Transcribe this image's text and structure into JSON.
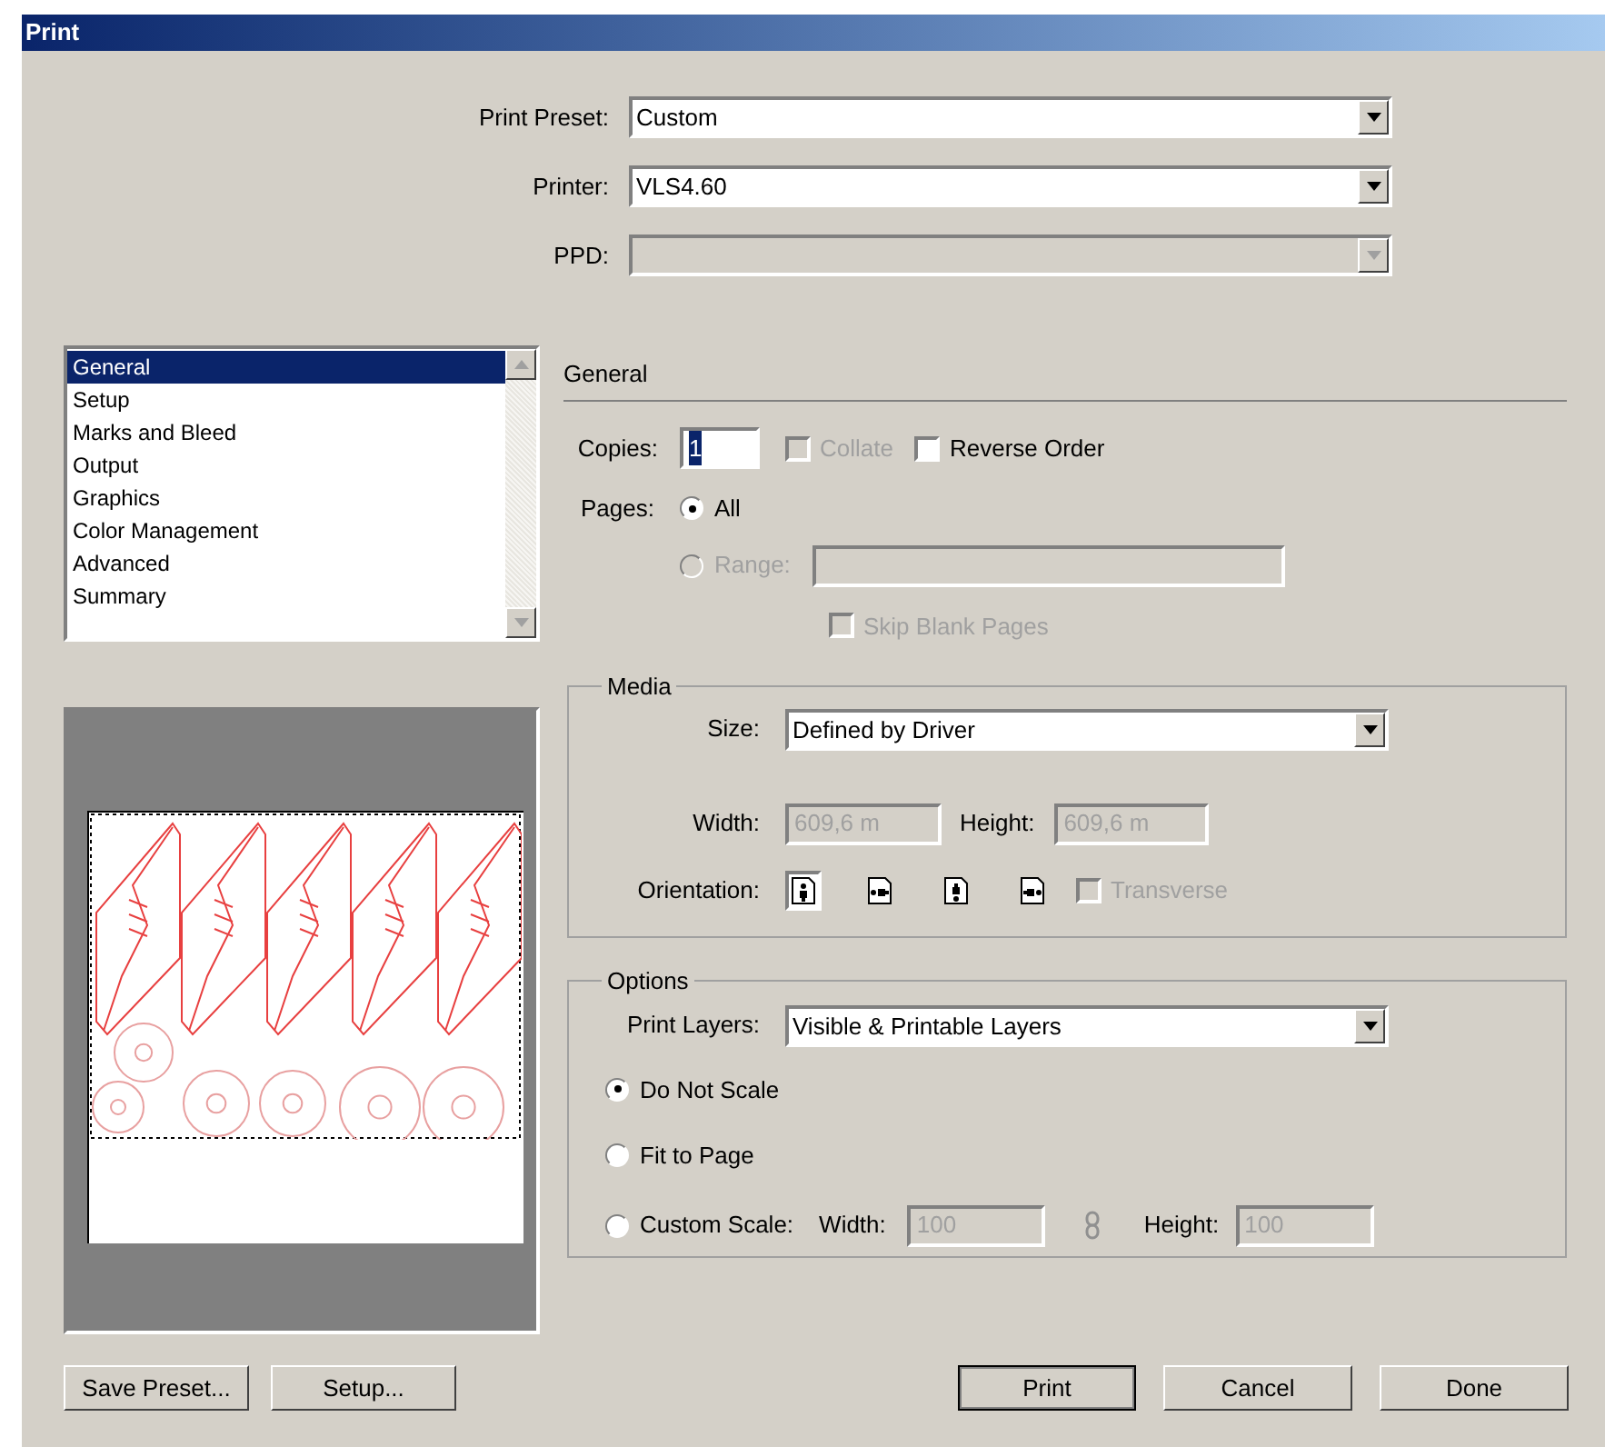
{
  "window": {
    "title": "Print"
  },
  "top_fields": [
    {
      "label": "Print Preset:",
      "value": "Custom",
      "disabled": false
    },
    {
      "label": "Printer:",
      "value": "VLS4.60",
      "disabled": false
    },
    {
      "label": "PPD:",
      "disabled": true
    }
  ],
  "categories": [
    {
      "label": "General",
      "selected": true
    },
    {
      "label": "Setup",
      "selected": false
    },
    {
      "label": "Marks and Bleed",
      "selected": false
    },
    {
      "label": "Output",
      "selected": false
    },
    {
      "label": "Graphics",
      "selected": false
    },
    {
      "label": "Color Management",
      "selected": false
    },
    {
      "label": "Advanced",
      "selected": false
    },
    {
      "label": "Summary",
      "selected": false
    }
  ],
  "general": {
    "heading": "General",
    "copies": {
      "label": "Copies:",
      "value": "1"
    },
    "collate": {
      "label": "Collate",
      "checked": false,
      "disabled": true
    },
    "reverse_order": {
      "label": "Reverse Order",
      "checked": false,
      "disabled": false
    },
    "pages": {
      "label": "Pages:",
      "options": [
        {
          "label": "All",
          "selected": true,
          "disabled": false
        },
        {
          "label": "Range:",
          "selected": false,
          "disabled": true
        }
      ]
    },
    "range_field": {
      "disabled": true
    },
    "skip_blank_pages": {
      "label": "Skip Blank Pages",
      "checked": false,
      "disabled": true
    }
  },
  "media": {
    "title": "Media",
    "size": {
      "label": "Size:",
      "value": "Defined by Driver"
    },
    "width": {
      "label": "Width:",
      "value": "609,6 m",
      "disabled": true
    },
    "height": {
      "label": "Height:",
      "value": "609,6 m",
      "disabled": true
    },
    "orientation": {
      "label": "Orientation:",
      "options": [
        {
          "selected": true
        },
        {
          "selected": false
        },
        {
          "selected": false
        },
        {
          "selected": false
        }
      ]
    },
    "transverse": {
      "label": "Transverse",
      "checked": false,
      "disabled": true
    }
  },
  "options": {
    "title": "Options",
    "print_layers": {
      "label": "Print Layers:",
      "value": "Visible & Printable Layers"
    },
    "scale": [
      {
        "label": "Do Not Scale",
        "selected": true
      },
      {
        "label": "Fit to Page",
        "selected": false
      },
      {
        "label": "Custom Scale:",
        "selected": false
      }
    ],
    "custom_width": {
      "label": "Width:",
      "value": "100",
      "disabled": true
    },
    "custom_height": {
      "label": "Height:",
      "value": "100",
      "disabled": true
    }
  },
  "left_buttons": [
    {
      "label": "Save Preset...",
      "default": false
    },
    {
      "label": "Setup...",
      "default": false
    }
  ],
  "right_buttons": [
    {
      "label": "Print",
      "default": true
    },
    {
      "label": "Cancel",
      "default": false
    },
    {
      "label": "Done",
      "default": false
    }
  ]
}
